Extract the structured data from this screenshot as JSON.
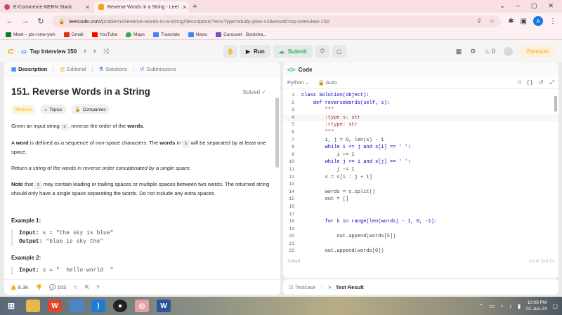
{
  "browser": {
    "tabs": [
      {
        "title": "E-Commerce MERN Stack.",
        "color": "#c34e5d"
      },
      {
        "title": "Reverse Words in a String - Leet",
        "color": "#f89f1b"
      }
    ],
    "url_host": "leetcode.com",
    "url_rest": "/problems/reverse-words-in-a-string/description/?envType=study-plan-v2&envId=top-interview-150",
    "profile_letter": "A",
    "bookmarks": [
      {
        "label": "Meet – jdv-rsnw-ywh",
        "color": "#00832d"
      },
      {
        "label": "Gmail",
        "color": "#d93025"
      },
      {
        "label": "YouTube",
        "color": "#ff0000"
      },
      {
        "label": "Maps",
        "color": "#34a853"
      },
      {
        "label": "Translate",
        "color": "#4285f4"
      },
      {
        "label": "News",
        "color": "#4285f4"
      },
      {
        "label": "Carousel · Bootstra...",
        "color": "#7952b3"
      }
    ]
  },
  "lc_nav": {
    "list_title": "Top Interview 150",
    "run_label": "Run",
    "submit_label": "Submit",
    "fire_count": "0",
    "premium_label": "Premium"
  },
  "left": {
    "tabs": [
      "Description",
      "Editorial",
      "Solutions",
      "Submissions"
    ],
    "title": "151. Reverse Words in a String",
    "solved_label": "Solved",
    "chips": [
      "Medium",
      "Topics",
      "Companies"
    ],
    "p1_a": "Given an input string ",
    "p1_code": "s",
    "p1_b": ", reverse the order of the ",
    "p1_bold": "words",
    "p1_c": ".",
    "p2_a": "A ",
    "p2_bold": "word",
    "p2_b": " is defined as a sequence of non-space characters. The ",
    "p2_bold2": "words",
    "p2_c": " in ",
    "p2_code": "s",
    "p2_d": " will be separated by at least one space.",
    "p3_a": "Return ",
    "p3_i": "a string of the words in reverse order concatenated by a single space.",
    "p4_bold": "Note",
    "p4_a": " that ",
    "p4_code": "s",
    "p4_b": " may contain leading or trailing spaces or multiple spaces between two words. The returned string should only have a single space separating the words. Do not include any extra spaces.",
    "ex1_title": "Example 1:",
    "ex1_input_label": "Input:",
    "ex1_input": "s = \"the sky is blue\"",
    "ex1_output_label": "Output:",
    "ex1_output": "\"blue is sky the\"",
    "ex2_title": "Example 2:",
    "ex2_input_label": "Input:",
    "ex2_input": "s = \"  hello world  \"",
    "likes": "8.3K",
    "comments": "153"
  },
  "right": {
    "header": "Code",
    "language": "Python",
    "auto_label": "Auto",
    "code_lines": [
      "class Solution(object):",
      "    def reverseWords(self, s):",
      "        \"\"\"",
      "        :type s: str",
      "        :rtype: str",
      "        \"\"\"",
      "        i, j = 0, len(s) - 1",
      "        while i <= j and s[i] == ' ':",
      "            i += 1",
      "        while j >= i and s[j] == ' ':",
      "            j -= 1",
      "        s = s[i : j + 1]",
      "",
      "        words = s.split()",
      "        out = []",
      "",
      "",
      "        for k in range(len(words) - 1, 0, -1):",
      "",
      "            out.append(words[k])",
      "",
      "        out.append(words[0])"
    ],
    "line_numbers": [
      "1",
      "2",
      "3",
      "4",
      "5",
      "6",
      "7",
      "8",
      "9",
      "10",
      "11",
      "12",
      "13",
      "14",
      "15",
      "16",
      "17",
      "18",
      "19",
      "20",
      "21",
      "22"
    ],
    "saved_label": "Saved",
    "cursor_pos": "Ln 4, Col 21",
    "testcase_label": "Testcase",
    "test_result_label": "Test Result"
  },
  "taskbar": {
    "time": "10:08 PM",
    "date": "01-Jun-24"
  }
}
